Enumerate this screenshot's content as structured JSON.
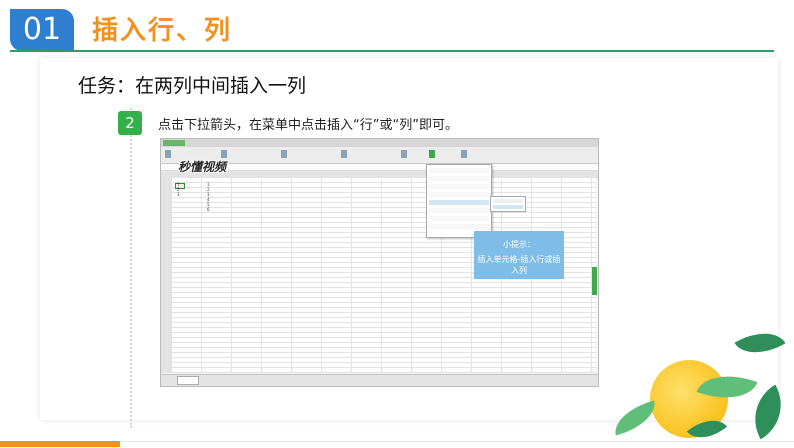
{
  "header": {
    "number": "01",
    "title": "插入行、列"
  },
  "content": {
    "task": "任务：在两列中间插入一列",
    "step_number": "2",
    "step_text": "点击下拉箭头，在菜单中点击插入“行”或“列”即可。"
  },
  "screenshot": {
    "watermark": "秒懂视频",
    "cells": [
      "1",
      "2",
      "3",
      "1",
      "2",
      "3",
      "4",
      "5",
      "6"
    ]
  },
  "tip": {
    "title": "小提示：",
    "text": "插入单元格-插入行或插入列"
  },
  "colors": {
    "accent_blue": "#2f7fd0",
    "title_orange": "#f0921f",
    "step_green": "#34b04a",
    "tip_blue": "#7fbde8"
  }
}
